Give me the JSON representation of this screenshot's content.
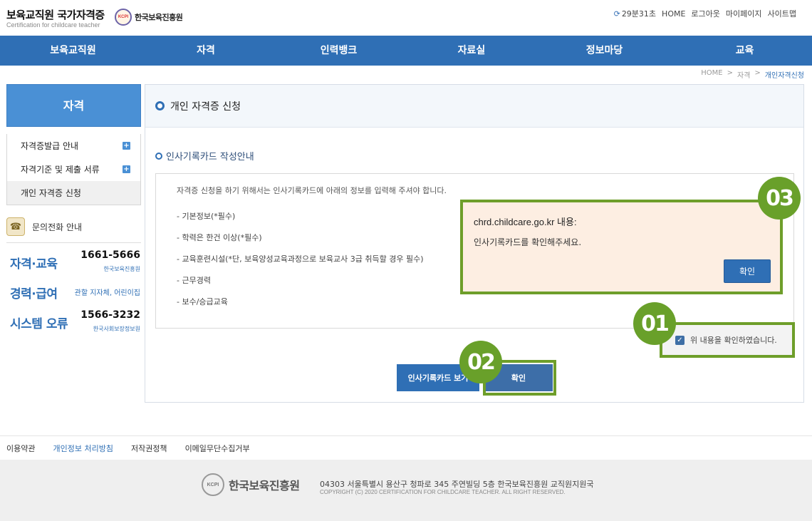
{
  "header": {
    "site_title": "보육교직원 국가자격증",
    "site_subtitle": "Certification for childcare teacher",
    "org_logo_mark": "KCPI",
    "org_logo_name": "한국보육진흥원",
    "timer": "29분31초",
    "util_links": [
      "HOME",
      "로그아웃",
      "마이페이지",
      "사이트맵"
    ]
  },
  "nav": [
    "보육교직원",
    "자격",
    "인력뱅크",
    "자료실",
    "정보마당",
    "교육"
  ],
  "breadcrumb": [
    "HOME",
    ">",
    "자격",
    ">",
    "개인자격신청"
  ],
  "sidebar": {
    "title": "자격",
    "items": [
      {
        "label": "자격증발급 안내",
        "plus": "+"
      },
      {
        "label": "자격기준 및 제출 서류",
        "plus": "+"
      },
      {
        "label": "개인 자격증 신청"
      }
    ],
    "contact_title": "문의전화 안내",
    "contacts": [
      {
        "label": "자격·교육",
        "number": "1661-5666",
        "org": "한국보육진흥원"
      },
      {
        "label": "경력·급여",
        "note": "관할 지자체, 어린이집"
      },
      {
        "label": "시스템 오류",
        "number": "1566-3232",
        "org": "한국사회보장정보원"
      }
    ]
  },
  "main": {
    "page_title": "개인 자격증 신청",
    "section_title": "인사기록카드 작성안내",
    "intro": "자격증 신청을 하기 위해서는 인사기록카드에 아래의 정보를 입력해 주셔야 합니다.",
    "items": [
      "-  기본정보(*필수)",
      "-  학력은 한건 이상(*필수)",
      "-  교육훈련시설(*단, 보육양성교육과정으로 보육교사 3급 취득할 경우 필수)",
      "-  근무경력",
      "-  보수/승급교육"
    ],
    "agree_label": "위 내용을 확인하였습니다.",
    "btn_view_card": "인사기록카드 보기",
    "btn_confirm": "확인"
  },
  "dialog": {
    "title": "chrd.childcare.go.kr 내용:",
    "message": "인사기록카드를 확인해주세요.",
    "ok": "확인"
  },
  "badges": {
    "b1": "01",
    "b2": "02",
    "b3": "03"
  },
  "footer": {
    "links": [
      "이용약관",
      "개인정보 처리방침",
      "저작권정책",
      "이메일무단수집거부"
    ],
    "logo_mark": "KCPI",
    "logo_name": "한국보육진흥원",
    "address": "04303 서울특별시 용산구 청파로 345 주연빌딩 5층 한국보육진흥원 교직원지원국",
    "copyright": "COPYRIGHT (C) 2020 CERTIFICATION FOR CHILDCARE TEACHER. ALL RIGHT RESERVED."
  },
  "colors": {
    "primary": "#2f6fb5",
    "highlight": "#6e9e2a",
    "dialog_bg": "#fdeee2"
  }
}
